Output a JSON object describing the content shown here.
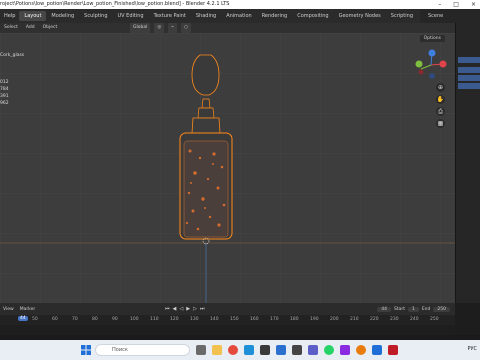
{
  "window": {
    "title": "roject\\Potions\\low_potion\\Render\\Low_potion_Finished\\low_potion.blend] - Blender 4.2.1 LTS"
  },
  "menubar": {
    "items": [
      "Help"
    ],
    "workspaces": [
      "Layout",
      "Modeling",
      "Sculpting",
      "UV Editing",
      "Texture Paint",
      "Shading",
      "Animation",
      "Rendering",
      "Compositing",
      "Geometry Nodes",
      "Scripting"
    ],
    "active_workspace": "Layout",
    "scene_label": "Scene"
  },
  "viewport_header": {
    "menu_items": [
      "Select",
      "Add",
      "Object"
    ],
    "orientation": "Global",
    "options_label": "Options"
  },
  "viewport_info": {
    "object_name": "Cork_glass",
    "stats": [
      "012",
      "784",
      "391",
      "962"
    ]
  },
  "gizmo": {
    "axes": [
      "X",
      "Y",
      "Z"
    ],
    "colors": {
      "x": "#e2434b",
      "y": "#7fbf3f",
      "z": "#3f7fe0"
    }
  },
  "timeline": {
    "menu_items": [
      "View",
      "Marker"
    ],
    "current_frame": "44",
    "start_label": "Start",
    "start_value": "1",
    "end_label": "End",
    "end_value": "250",
    "ruler_ticks": [
      "44",
      "50",
      "60",
      "70",
      "80",
      "90",
      "100",
      "110",
      "120",
      "130",
      "140",
      "150",
      "160",
      "170",
      "180",
      "190",
      "200",
      "210",
      "220",
      "230",
      "240",
      "250"
    ]
  },
  "taskbar": {
    "search_placeholder": "Поиск",
    "lang": "РУС"
  },
  "accent_color": "#ff8a1a",
  "selection_color": "#4773c4"
}
